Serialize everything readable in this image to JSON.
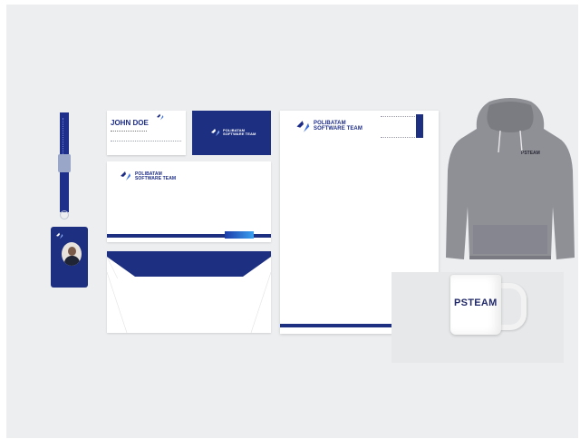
{
  "brand": {
    "name_line1": "POLIBATAM",
    "name_line2": "SOFTWARE TEAM",
    "short": "PSTEAM",
    "accent_color": "#1d2f80",
    "gradient_colors": [
      "#1d3ca8",
      "#3aa0f0"
    ]
  },
  "business_card": {
    "name": "JOHN DOE"
  },
  "scene": {
    "background_color": "#eceef0",
    "items": [
      "lanyard-id-badge",
      "business-cards",
      "envelope",
      "open-envelope",
      "letterhead",
      "hoodie",
      "mug"
    ]
  }
}
